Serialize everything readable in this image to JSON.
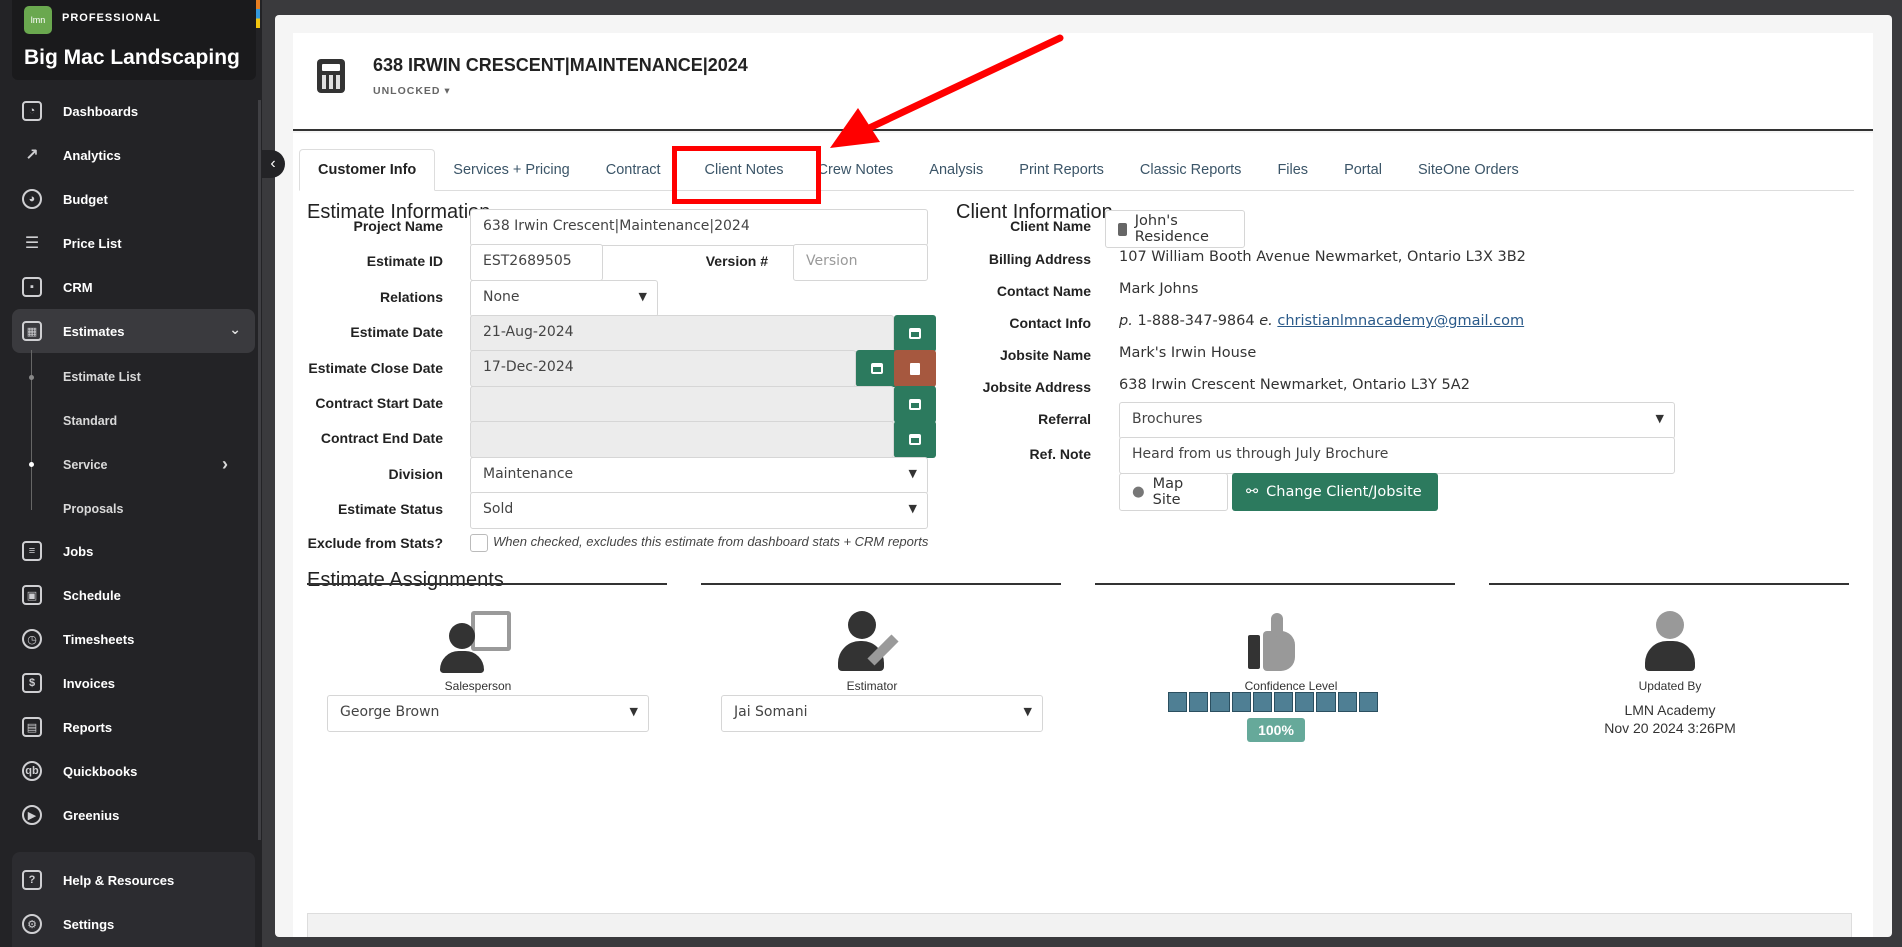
{
  "brand": {
    "logo": "lmn",
    "edition": "PROFESSIONAL",
    "company": "Big Mac Landscaping"
  },
  "nav": {
    "dashboards": "Dashboards",
    "analytics": "Analytics",
    "budget": "Budget",
    "price_list": "Price List",
    "crm": "CRM",
    "estimates": "Estimates",
    "estimate_list": "Estimate List",
    "standard": "Standard",
    "service": "Service",
    "proposals": "Proposals",
    "jobs": "Jobs",
    "schedule": "Schedule",
    "timesheets": "Timesheets",
    "invoices": "Invoices",
    "reports": "Reports",
    "quickbooks": "Quickbooks",
    "greenius": "Greenius",
    "help": "Help & Resources",
    "settings": "Settings"
  },
  "header": {
    "title": "638 IRWIN CRESCENT|MAINTENANCE|2024",
    "lock_status": "UNLOCKED"
  },
  "tabs": {
    "customer_info": "Customer Info",
    "services_pricing": "Services + Pricing",
    "contract": "Contract",
    "client_notes": "Client Notes",
    "crew_notes": "Crew Notes",
    "analysis": "Analysis",
    "print_reports": "Print Reports",
    "classic_reports": "Classic Reports",
    "files": "Files",
    "portal": "Portal",
    "siteone_orders": "SiteOne Orders"
  },
  "estimate": {
    "section_title": "Estimate Information",
    "project_name_label": "Project Name",
    "project_name": "638 Irwin Crescent|Maintenance|2024",
    "estimate_id_label": "Estimate ID",
    "estimate_id": "EST2689505",
    "version_label": "Version #",
    "version_placeholder": "Version",
    "relations_label": "Relations",
    "relations": "None",
    "estimate_date_label": "Estimate Date",
    "estimate_date": "21-Aug-2024",
    "close_date_label": "Estimate Close Date",
    "close_date": "17-Dec-2024",
    "contract_start_label": "Contract Start Date",
    "contract_start": "",
    "contract_end_label": "Contract End Date",
    "contract_end": "",
    "division_label": "Division",
    "division": "Maintenance",
    "status_label": "Estimate Status",
    "status": "Sold",
    "exclude_label": "Exclude from Stats?",
    "exclude_hint": "When checked, excludes this estimate from dashboard stats + CRM reports"
  },
  "client": {
    "section_title": "Client Information",
    "client_name_label": "Client Name",
    "client_name": "John's Residence",
    "billing_label": "Billing Address",
    "billing": "107 William Booth Avenue Newmarket, Ontario L3X 3B2",
    "contact_name_label": "Contact Name",
    "contact_name": "Mark Johns",
    "contact_info_label": "Contact Info",
    "phone_prefix": "p.",
    "phone": "1-888-347-9864",
    "email_prefix": "e.",
    "email": "christianlmnacademy@gmail.com",
    "jobsite_name_label": "Jobsite Name",
    "jobsite_name": "Mark's Irwin House",
    "jobsite_address_label": "Jobsite Address",
    "jobsite_address": "638 Irwin Crescent Newmarket, Ontario L3Y 5A2",
    "referral_label": "Referral",
    "referral": "Brochures",
    "ref_note_label": "Ref. Note",
    "ref_note": "Heard from us through July Brochure",
    "map_site": "Map Site",
    "change_client": "Change Client/Jobsite"
  },
  "assignments": {
    "section_title": "Estimate Assignments",
    "salesperson_label": "Salesperson",
    "salesperson": "George Brown",
    "estimator_label": "Estimator",
    "estimator": "Jai Somani",
    "confidence_label": "Confidence Level",
    "confidence_pct": "100%",
    "confidence_fraction": 1.0,
    "updated_by_label": "Updated By",
    "updated_by": "LMN Academy",
    "updated_at": "Nov 20 2024 3:26PM"
  },
  "colors": {
    "accent_green": "#2c7a5e",
    "danger": "#a6583f",
    "annotation": "#ff0000",
    "sidebar": "#232326"
  }
}
